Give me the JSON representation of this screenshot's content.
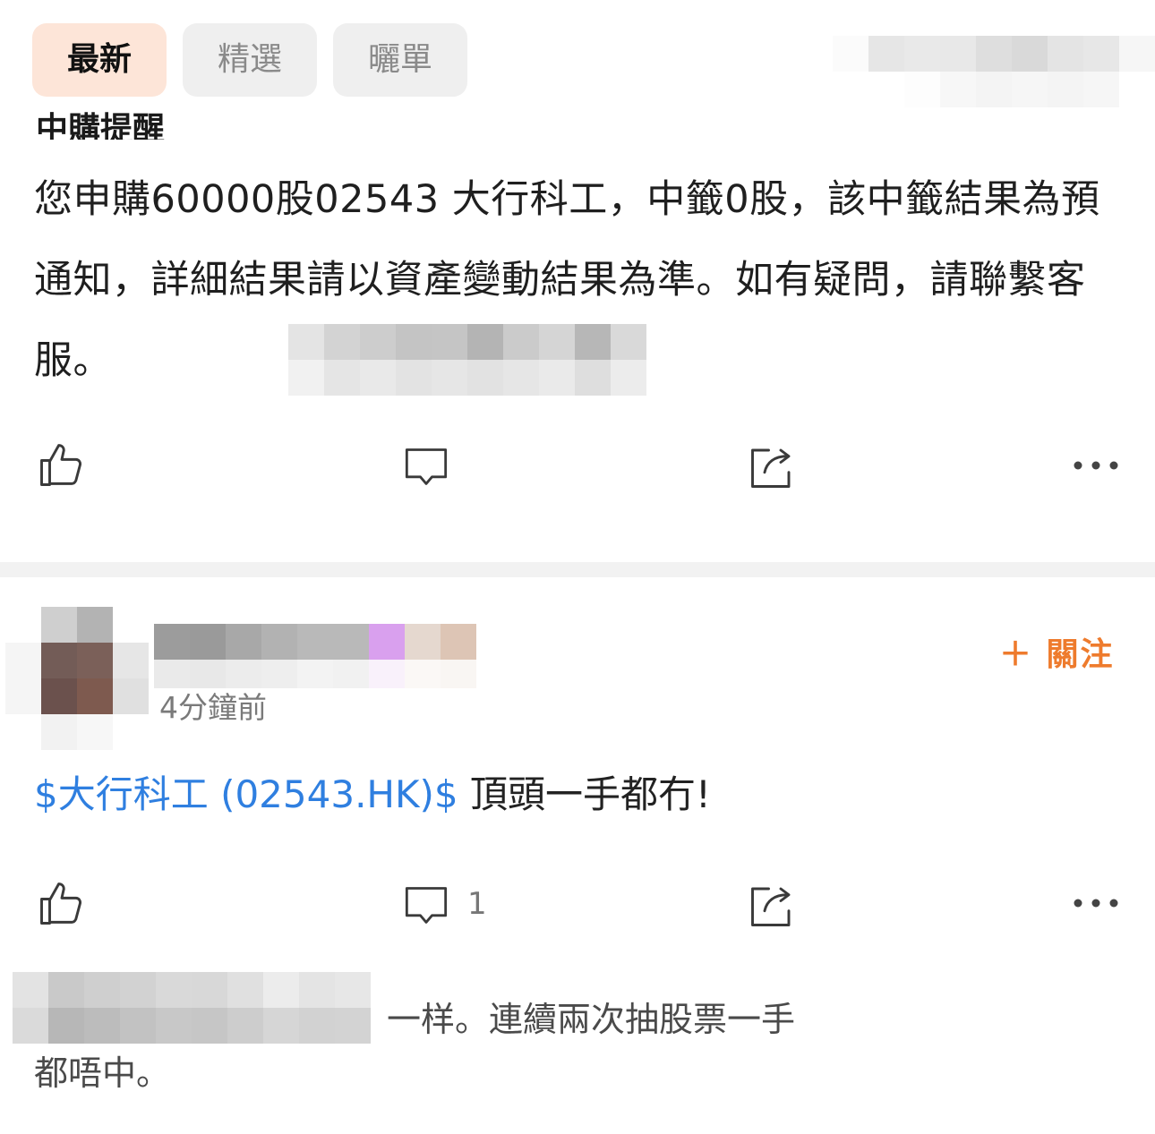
{
  "tabs": [
    {
      "label": "最新",
      "active": true
    },
    {
      "label": "精選",
      "active": false
    },
    {
      "label": "曬單",
      "active": false
    }
  ],
  "post1": {
    "title": "中購提醒",
    "body": "您申購60000股02543  大行科工，中籤0股，該中籤結果為預通知，詳細結果請以資產變動結果為準。如有疑問，請聯繫客服。"
  },
  "post2": {
    "follow_label": "＋ 關注",
    "time": "4分鐘前",
    "stock_link": "$大行科工 (02543.HK)$",
    "text": " 頂頭一手都冇!",
    "comment_count": "1",
    "reply_text_1": "一样。連續兩次抽股票一手",
    "reply_text_2": "都唔中。"
  },
  "colors": {
    "accent": "#ee7b2d",
    "link": "#2f7fe0",
    "active_tab_bg": "#fde5d8",
    "tab_bg": "#efefef"
  },
  "icons": [
    "like-icon",
    "comment-icon",
    "share-icon",
    "more-icon"
  ]
}
